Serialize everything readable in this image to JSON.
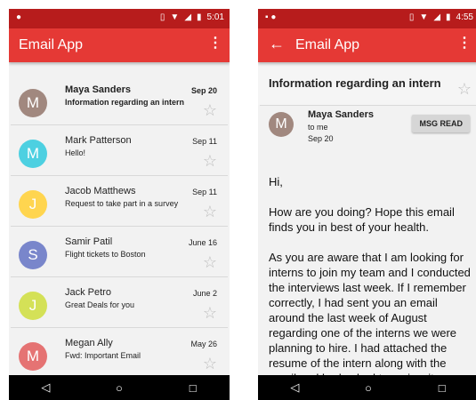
{
  "left": {
    "status": {
      "time": "5:01"
    },
    "app_bar": {
      "title": "Email App",
      "overflow_icon": "⋮"
    },
    "emails": [
      {
        "sender": "Maya Sanders",
        "subject": "Information regarding an intern",
        "date": "Sep 20",
        "initial": "M",
        "avatar_color": "#a1887f",
        "unread": true
      },
      {
        "sender": "Mark Patterson",
        "subject": "Hello!",
        "date": "Sep 11",
        "initial": "M",
        "avatar_color": "#4dd0e1",
        "unread": false
      },
      {
        "sender": "Jacob Matthews",
        "subject": "Request to take part in a survey",
        "date": "Sep 11",
        "initial": "J",
        "avatar_color": "#ffd54f",
        "unread": false
      },
      {
        "sender": "Samir Patil",
        "subject": "Flight tickets to Boston",
        "date": "June 16",
        "initial": "S",
        "avatar_color": "#7986cb",
        "unread": false
      },
      {
        "sender": "Jack Petro",
        "subject": "Great Deals for you",
        "date": "June 2",
        "initial": "J",
        "avatar_color": "#d4e157",
        "unread": false
      },
      {
        "sender": "Megan Ally",
        "subject": "Fwd: Important Email",
        "date": "May 26",
        "initial": "M",
        "avatar_color": "#e57373",
        "unread": false
      }
    ]
  },
  "right": {
    "status": {
      "time": "4:55"
    },
    "app_bar": {
      "title": "Email App",
      "back_icon": "←",
      "overflow_icon": "⋮"
    },
    "mail": {
      "subject": "Information regarding an intern",
      "sender": "Maya Sanders",
      "to": "to me",
      "date": "Sep 20",
      "initial": "M",
      "msg_read_label": "MSG READ",
      "body": [
        "Hi,",
        "How are you doing? Hope this email finds you in best of your health.",
        "As you are aware that I am looking for interns to join my team and I conducted the interviews last week. If I remember correctly, I had sent you an email around the last week of August regarding one of the interns we were planning to hire. I had attached the resume of the intern along with the email and had asked to review it. Unfortunately I can't"
      ]
    }
  },
  "nav": {
    "back_icon": "◁",
    "home_icon": "○",
    "recents_icon": "□"
  },
  "colors": {
    "status_bar": "#b71c1c",
    "app_bar": "#e53935",
    "accent": "#e53935"
  }
}
